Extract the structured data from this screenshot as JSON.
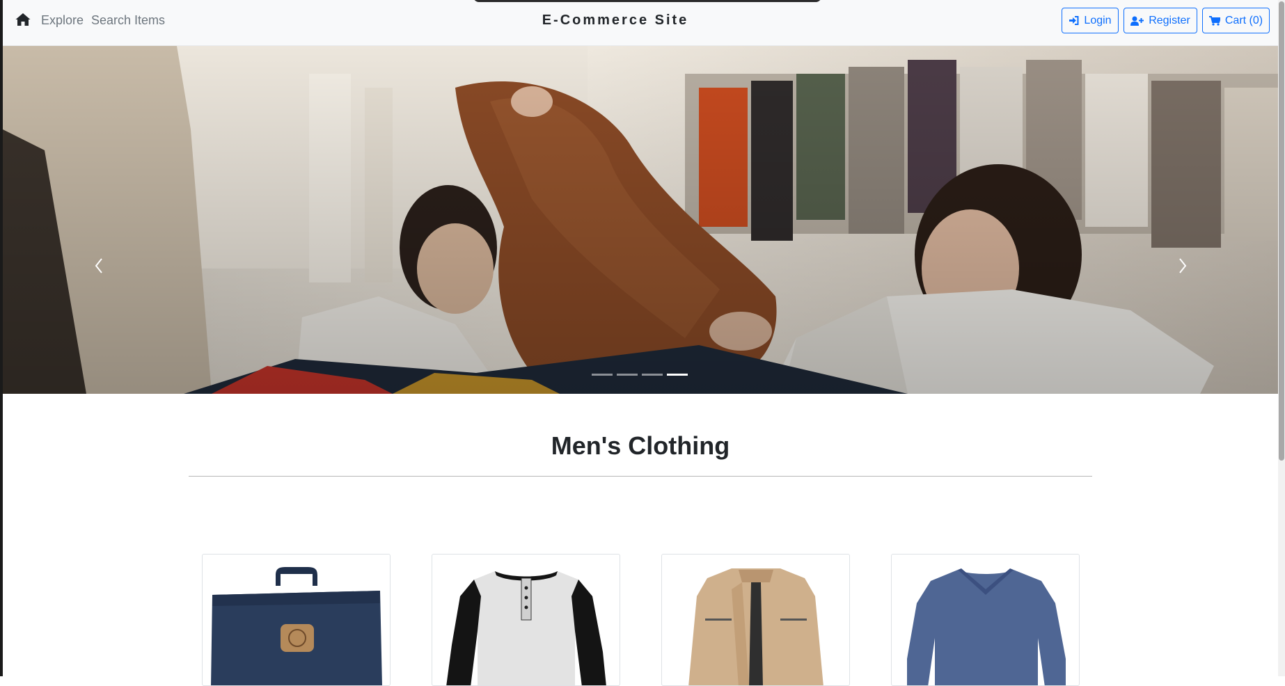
{
  "navbar": {
    "home_icon": "home-icon",
    "links": [
      "Explore",
      "Search Items"
    ],
    "brand": "E-Commerce Site",
    "login_label": "Login",
    "register_label": "Register",
    "cart_label": "Cart (0)"
  },
  "carousel": {
    "indicator_count": 4,
    "active_indicator": 4
  },
  "section": {
    "title": "Men's Clothing"
  },
  "colors": {
    "primary": "#0d6efd",
    "navbar_bg": "#f8f9fa",
    "text": "#212529",
    "muted": "#6c757d"
  }
}
